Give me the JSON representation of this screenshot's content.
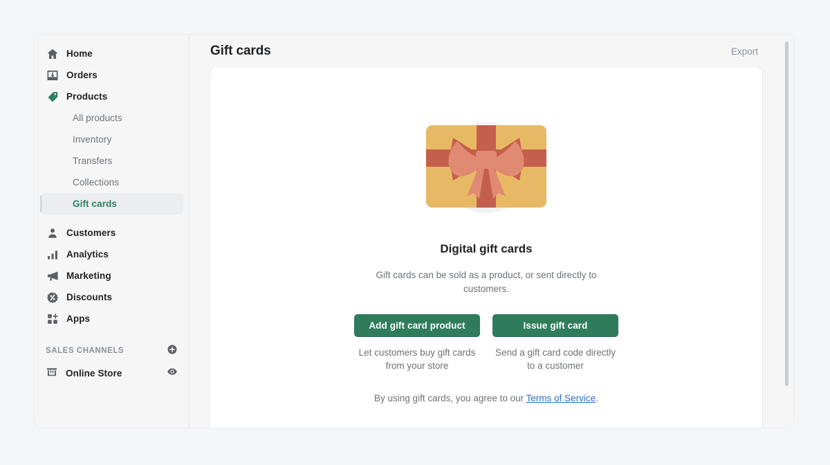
{
  "window": {
    "title": "Gift cards"
  },
  "sidebar": {
    "items": [
      {
        "label": "Home",
        "icon": "home-icon"
      },
      {
        "label": "Orders",
        "icon": "orders-inbox-icon"
      },
      {
        "label": "Products",
        "icon": "products-tag-icon"
      }
    ],
    "product_subitems": [
      {
        "label": "All products",
        "active": false
      },
      {
        "label": "Inventory",
        "active": false
      },
      {
        "label": "Transfers",
        "active": false
      },
      {
        "label": "Collections",
        "active": false
      },
      {
        "label": "Gift cards",
        "active": true
      }
    ],
    "items_lower": [
      {
        "label": "Customers",
        "icon": "customer-person-icon"
      },
      {
        "label": "Analytics",
        "icon": "analytics-bars-icon"
      },
      {
        "label": "Marketing",
        "icon": "marketing-megaphone-icon"
      },
      {
        "label": "Discounts",
        "icon": "discount-badge-icon"
      },
      {
        "label": "Apps",
        "icon": "apps-grid-plus-icon"
      }
    ],
    "sales_channels": {
      "title": "SALES CHANNELS",
      "add_icon": "plus-circle-icon",
      "channels": [
        {
          "label": "Online Store",
          "icon": "storefront-icon",
          "action_icon": "eye-icon"
        }
      ]
    }
  },
  "header": {
    "title": "Gift cards",
    "export_label": "Export"
  },
  "empty_state": {
    "illustration": "gift-card-illustration",
    "title": "Digital gift cards",
    "description": "Gift cards can be sold as a product, or sent directly to customers.",
    "primary_actions": [
      {
        "button_label": "Add gift card product",
        "caption": "Let customers buy gift cards from your store"
      },
      {
        "button_label": "Issue gift card",
        "caption": "Send a gift card code directly to a customer"
      }
    ],
    "terms_prefix": "By using gift cards, you agree to our ",
    "terms_link": "Terms of Service",
    "terms_suffix": "."
  },
  "colors": {
    "brand_green": "#2f7c5d",
    "active_green": "#2e8062",
    "link_blue": "#2c6ecb",
    "page_background": "#f4f6f8",
    "surface": "#f6f6f7",
    "card": "#ffffff",
    "gift_card_body": "#e8b964",
    "gift_ribbon": "#c45f4e",
    "gift_bow": "#e08a73"
  }
}
